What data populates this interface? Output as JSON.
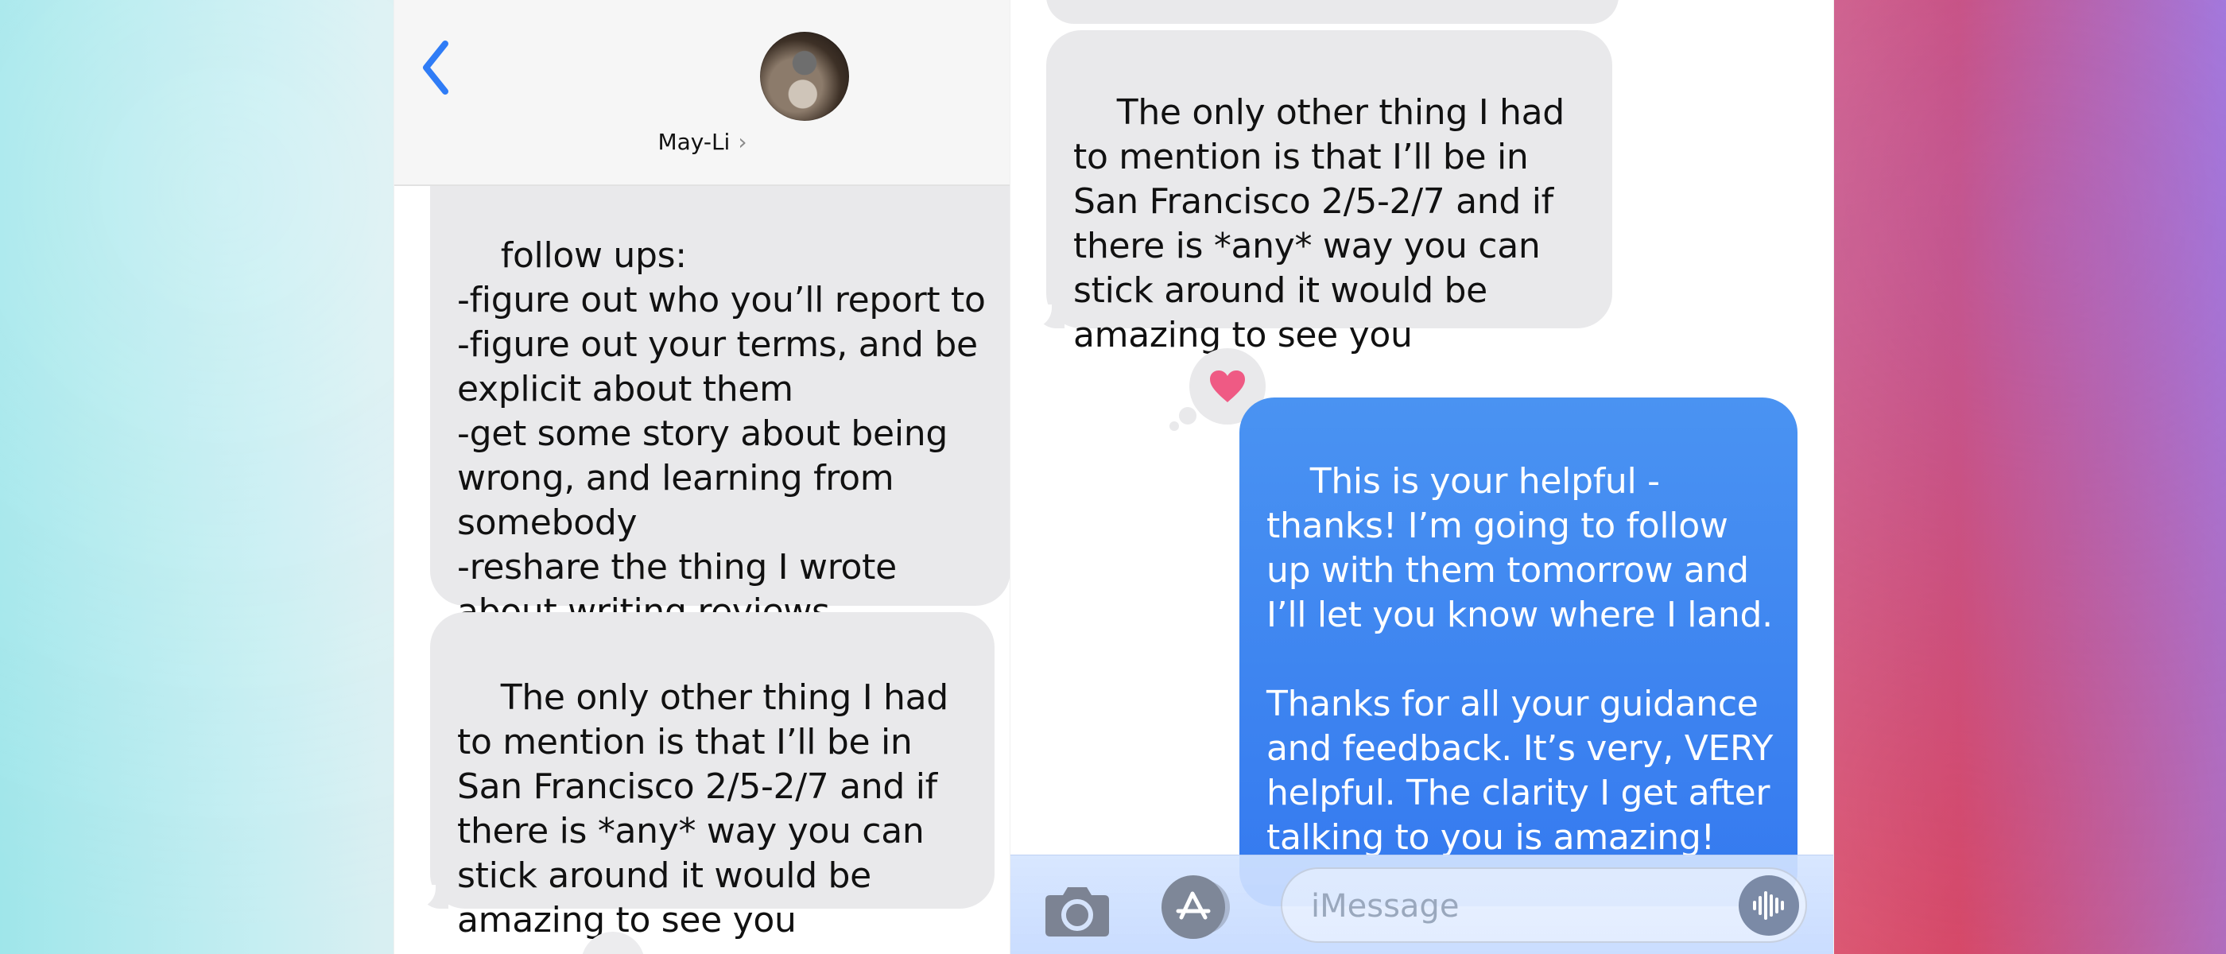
{
  "header": {
    "contact_name": "May-Li",
    "name_chevron": "›"
  },
  "left": {
    "bubble_1": "follow ups:\n-figure out who you’ll report to\n-figure out your terms, and be explicit about them\n-get some story about being wrong, and learning from somebody\n-reshare the thing I wrote about writing reviews",
    "bubble_2": "The only other thing I had to mention is that I’ll be in San Francisco 2/5-2/7 and if there is *any* way you can stick around it would be amazing to see you"
  },
  "right": {
    "bubble_1": "The only other thing I had to mention is that I’ll be in San Francisco 2/5-2/7 and if there is *any* way you can stick around it would be amazing to see you",
    "reaction": "heart",
    "bubble_2": "This is your helpful - thanks! I’m going to follow up with them tomorrow and I’ll let you know where I land.\n\nThanks for all your guidance and feedback. It’s very, VERY helpful. The clarity I get after talking to you is amazing!"
  },
  "composer": {
    "placeholder": "iMessage",
    "value": ""
  },
  "icons": {
    "back": "chevron-left-icon",
    "camera": "camera-icon",
    "apps": "app-store-icon",
    "audio": "audio-waveform-icon",
    "reaction": "heart-icon"
  },
  "colors": {
    "ios_blue": "#3479ef",
    "incoming_bubble": "#e9e9eb",
    "heart_pink": "#ef5a84"
  }
}
